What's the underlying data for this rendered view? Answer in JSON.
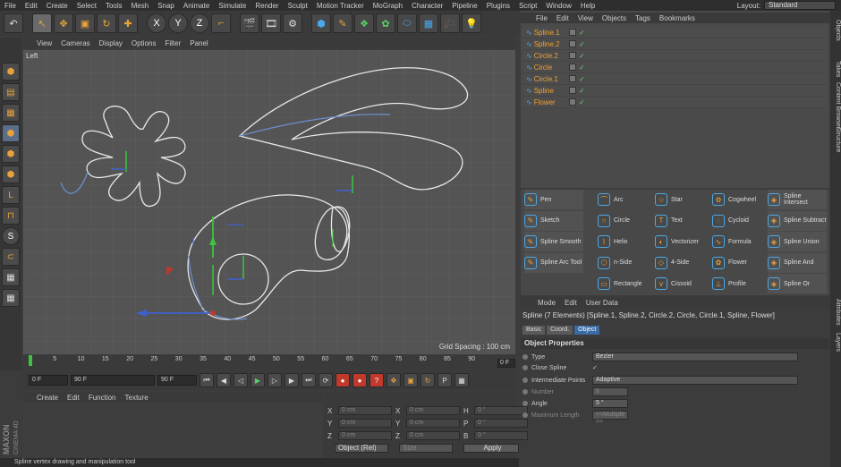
{
  "menubar": {
    "items": [
      "File",
      "Edit",
      "Create",
      "Select",
      "Tools",
      "Mesh",
      "Snap",
      "Animate",
      "Simulate",
      "Render",
      "Sculpt",
      "Motion Tracker",
      "MoGraph",
      "Character",
      "Pipeline",
      "Plugins",
      "Script",
      "Window",
      "Help"
    ],
    "layout_label": "Layout:",
    "layout_value": "Standard"
  },
  "toolbar": {
    "axis_x": "X",
    "axis_y": "Y",
    "axis_z": "Z"
  },
  "viewport": {
    "menu": [
      "View",
      "Cameras",
      "Display",
      "Options",
      "Filter",
      "Panel"
    ],
    "label": "Left",
    "grid_spacing": "Grid Spacing : 100 cm"
  },
  "timeline": {
    "ticks": [
      "0",
      "5",
      "10",
      "15",
      "20",
      "25",
      "30",
      "35",
      "40",
      "45",
      "50",
      "55",
      "60",
      "65",
      "70",
      "75",
      "80",
      "85",
      "90"
    ],
    "frame_field": "0 F",
    "start": "0 F",
    "current": "0 F",
    "end": "90 F",
    "end2": "90 F"
  },
  "material": {
    "menu": [
      "Create",
      "Edit",
      "Function",
      "Texture"
    ]
  },
  "coords": {
    "x_pos": "0 cm",
    "y_pos": "0 cm",
    "z_pos": "0 cm",
    "x_size": "0 cm",
    "y_size": "0 cm",
    "z_size": "0 cm",
    "h": "0 °",
    "p": "0 °",
    "b": "0 °",
    "mode": "Object (Rel)",
    "size_mode": "Size",
    "apply": "Apply"
  },
  "status": "Spline vertex drawing and manipulation tool",
  "brand": {
    "maxon": "MAXON",
    "c4d": "CINEMA 4D"
  },
  "objects": {
    "menu": [
      "File",
      "Edit",
      "View",
      "Objects",
      "Tags",
      "Bookmarks"
    ],
    "items": [
      "Spline.1",
      "Spline.2",
      "Circle.2",
      "Circle",
      "Circle.1",
      "Spline",
      "Flower"
    ]
  },
  "side_tabs": [
    "Objects",
    "Takes",
    "Content Browser",
    "Structure"
  ],
  "side_tabs2": [
    "Attributes",
    "Layers"
  ],
  "palette": [
    [
      "Pen",
      "Arc",
      "Star",
      "Cogwheel",
      "Spline Intersect"
    ],
    [
      "Sketch",
      "Circle",
      "Text",
      "Cycloid",
      "Spline Subtract"
    ],
    [
      "Spline Smooth",
      "Helix",
      "Vectorizer",
      "Formula",
      "Spline Union"
    ],
    [
      "Spline Arc Tool",
      "n-Side",
      "4-Side",
      "Flower",
      "Spline And"
    ],
    [
      "",
      "Rectangle",
      "Cissoid",
      "Profile",
      "Spline Or"
    ]
  ],
  "attributes": {
    "menu": [
      "Mode",
      "Edit",
      "User Data"
    ],
    "title": "Spline (7 Elements) [Spline.1, Spline.2, Circle.2, Circle, Circle.1, Spline, Flower]",
    "tabs": [
      "Basic",
      "Coord.",
      "Object"
    ],
    "section": "Object Properties",
    "rows": [
      {
        "label": "Type",
        "value": "Bezier"
      },
      {
        "label": "Close Spline",
        "value": "✓"
      },
      {
        "label": "Intermediate Points",
        "value": "Adaptive"
      },
      {
        "label": "Number",
        "value": "8"
      },
      {
        "label": "Angle",
        "value": "5 °"
      },
      {
        "label": "Maximum Length",
        "value": "<<Multiple >>"
      }
    ]
  }
}
